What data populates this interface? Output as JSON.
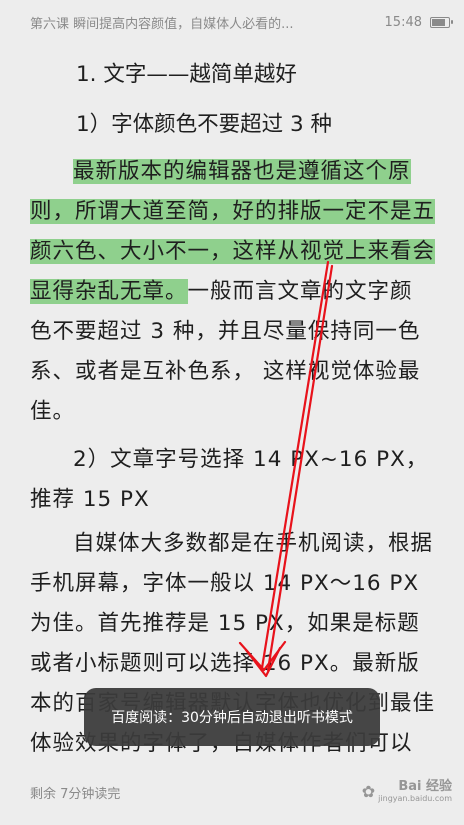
{
  "status_bar": {
    "chapter_title": "第六课 瞬间提高内容颜值，自媒体人必看的...",
    "time": "15:48"
  },
  "article": {
    "heading_1": "1. 文字——越简单越好",
    "sub_heading_1": "1）字体颜色不要超过 3 种",
    "para_1_highlighted": "最新版本的编辑器也是遵循这个原则，所谓大道至简，好的排版一定不是五颜六色、大小不一，这样从视觉上来看会显得杂乱无章。",
    "para_1_rest": "一般而言文章的文字颜色不要超过 3 种，并且尽量保持同一色系、或者是互补色系， 这样视觉体验最佳。",
    "sub_heading_2": "2）文章字号选择 14 PX~16 PX，推荐 15 PX",
    "para_2": "自媒体大多数都是在手机阅读，根据手机屏幕，字体一般以 14 PX～16 PX 为佳。首先推荐是 15 PX，如果是标题或者小标题则可以选择 16 PX。最新版本的百家号编辑器默认字体也优化到最佳体验效果的字体了，自媒体作者们可以"
  },
  "toast": {
    "message": "百度阅读：30分钟后自动退出听书模式"
  },
  "footer": {
    "remaining": "剩余 7分钟读完"
  },
  "watermark": {
    "brand": "Bai 经验",
    "url": "jingyan.baidu.com"
  },
  "colors": {
    "highlight": "#8fd08d",
    "annotation_arrow": "#e8121b",
    "background": "#ededed"
  },
  "battery_level": 0.85
}
